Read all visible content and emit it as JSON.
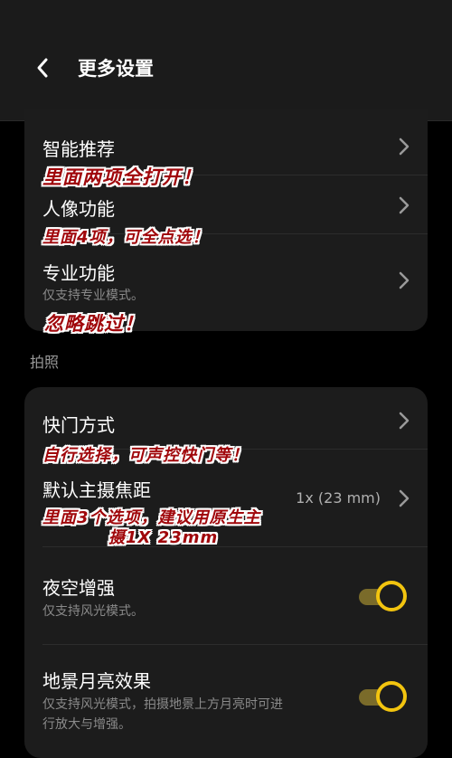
{
  "header": {
    "title": "更多设置"
  },
  "group1": {
    "items": [
      {
        "title": "智能推荐"
      },
      {
        "title": "人像功能"
      },
      {
        "title": "专业功能",
        "subtitle": "仅支持专业模式。"
      }
    ]
  },
  "section_label": "拍照",
  "group2": {
    "shutter": {
      "title": "快门方式"
    },
    "focal": {
      "title": "默认主摄焦距",
      "value": "1x (23 mm)"
    },
    "night": {
      "title": "夜空增强",
      "subtitle": "仅支持风光模式。",
      "on": true
    },
    "moon": {
      "title": "地景月亮效果",
      "subtitle_line1": "仅支持风光模式，拍摄地景上方月亮时可进",
      "subtitle_line2": "行放大与增强。",
      "on": true
    }
  },
  "annotations": {
    "a1": "里面两项全打开！",
    "a2": "里面4项，可全点选！",
    "a3": "忽略跳过！",
    "a4": "自行选择，可声控快门等！",
    "a5_line1": "里面3个选项，建议用原生主",
    "a5_line2": "摄1X 23mm"
  },
  "colors": {
    "accent": "#f2c40f",
    "annotation": "#a0070b"
  }
}
